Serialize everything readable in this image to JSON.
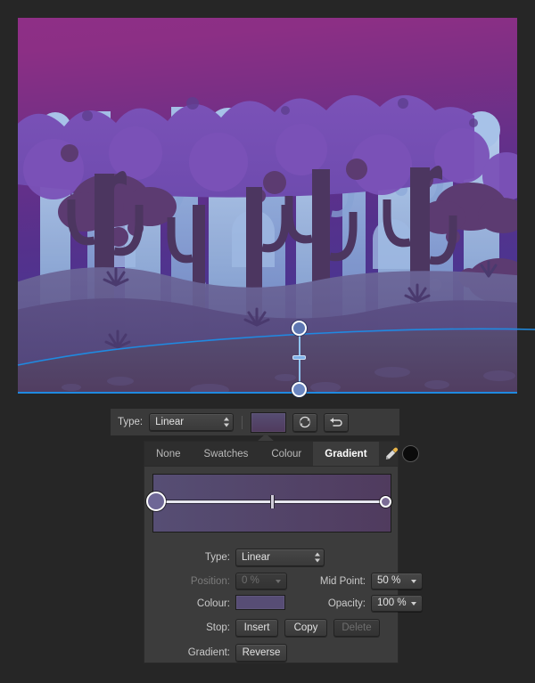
{
  "app": {
    "background_color": "#262626",
    "canvas_bounds": "20,20,560,420"
  },
  "artwork": {
    "title": "Forest night scene illustration",
    "sky_top_color": "#8e2f86",
    "sky_bottom_color": "#46378f",
    "back_tree_color": "#9fc0e8",
    "front_tree_color": "#4c3660",
    "ground_color": "#4a3a6e",
    "selection_color": "#1f8ae0"
  },
  "gradient_tool_overlay": {
    "handle_start_label": "gradient-start-handle",
    "handle_end_label": "gradient-end-handle",
    "midpoint_label": "gradient-midpoint-marker",
    "line_color": "#8fc4f0"
  },
  "toolbar": {
    "type_label": "Type:",
    "type_value": "Linear",
    "swatch_name": "current-gradient-swatch",
    "swatch_color": "#564d73",
    "rotate_icon": "rotate-icon",
    "reverse_icon": "reverse-arrow-icon"
  },
  "panel": {
    "tabs": [
      {
        "label": "None",
        "active": false
      },
      {
        "label": "Swatches",
        "active": false
      },
      {
        "label": "Colour",
        "active": false
      },
      {
        "label": "Gradient",
        "active": true
      }
    ],
    "tools": {
      "eyedropper_icon": "eyedropper-icon",
      "swatch_icon": "black-swatch-icon",
      "swatch_color": "#0b0b0b"
    },
    "preview": {
      "name": "gradient-preview-strip",
      "start_color": "#564e74",
      "end_color": "#503b5e",
      "stops": [
        {
          "position": "0 %",
          "color": "#6e6796",
          "selected": true
        },
        {
          "position": "100 %",
          "color": "#7b6c96",
          "selected": false
        }
      ],
      "midpoint": "50 %"
    },
    "fields": {
      "type_label": "Type:",
      "type_value": "Linear",
      "position_label": "Position:",
      "position_value": "0 %",
      "position_disabled": true,
      "midpoint_label": "Mid Point:",
      "midpoint_value": "50 %",
      "colour_label": "Colour:",
      "colour_value": "#574d75",
      "opacity_label": "Opacity:",
      "opacity_value": "100 %",
      "stop_label": "Stop:",
      "gradient_label": "Gradient:"
    },
    "buttons": {
      "insert": "Insert",
      "copy": "Copy",
      "delete": "Delete",
      "delete_disabled": true,
      "reverse": "Reverse"
    }
  }
}
